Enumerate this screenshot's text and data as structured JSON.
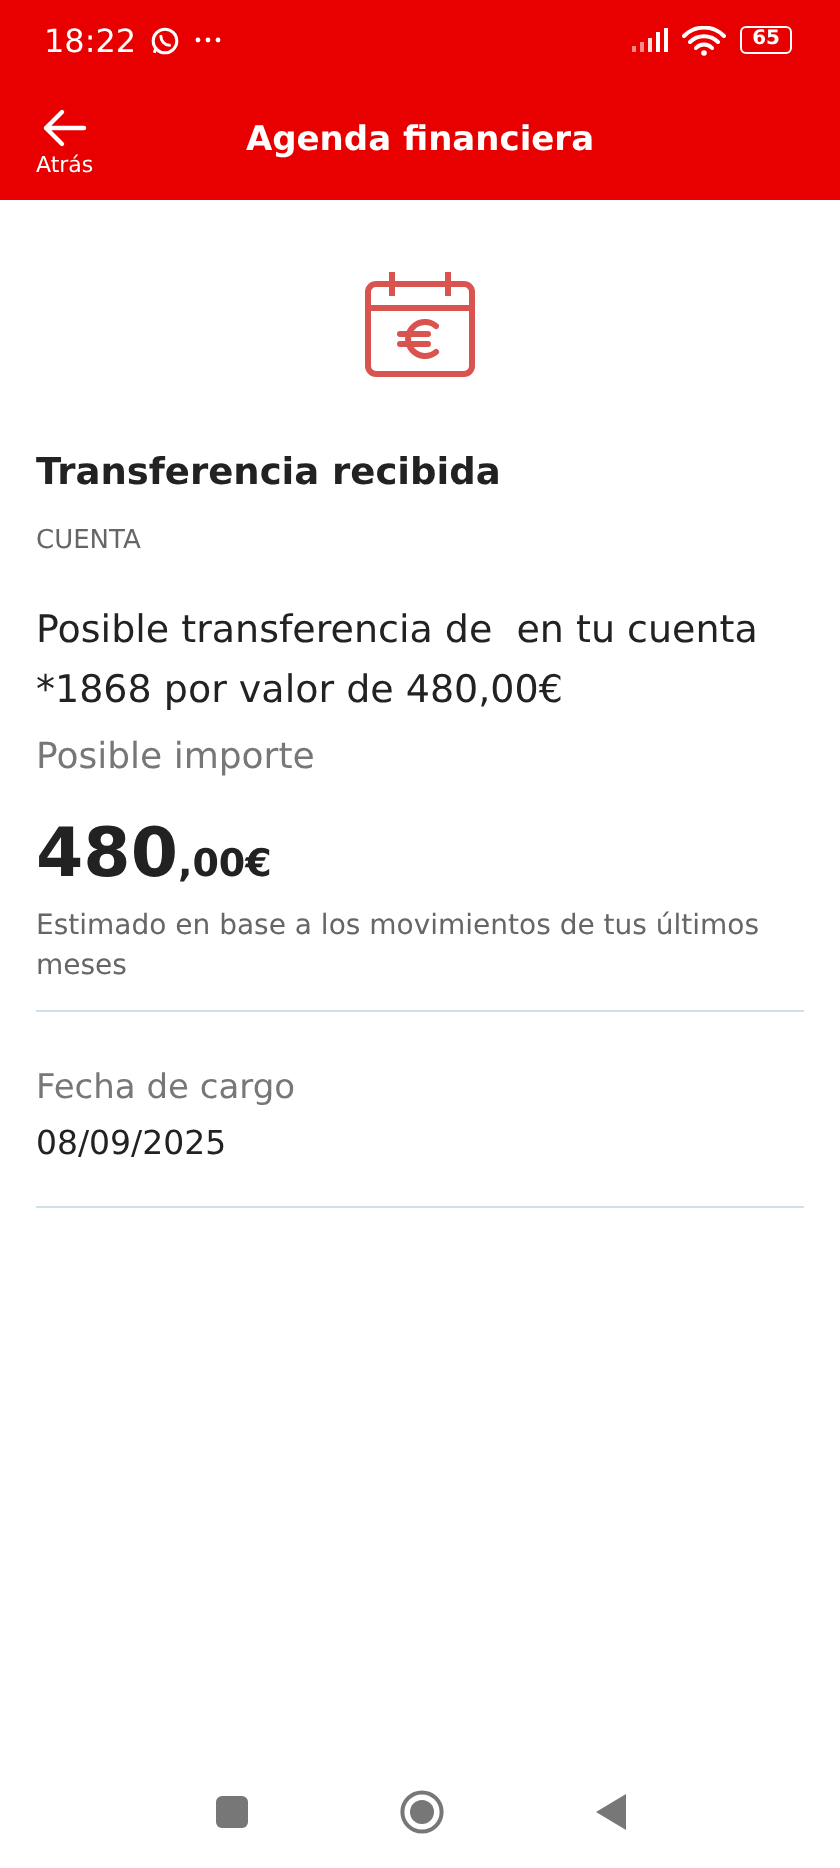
{
  "status_bar": {
    "time": "18:22",
    "battery": "65"
  },
  "header": {
    "back_label": "Atrás",
    "title": "Agenda financiera"
  },
  "detail": {
    "title": "Transferencia recibida",
    "category": "CUENTA",
    "description": "Posible transferencia de  en tu cuenta *1868 por valor de 480,00€",
    "amount_label": "Posible importe",
    "amount_integer": "480",
    "amount_decimals": ",00€",
    "estimate_note": "Estimado en base a los movimientos de tus últimos meses"
  },
  "fields": [
    {
      "label": "Fecha de cargo",
      "value": "08/09/2025"
    }
  ]
}
